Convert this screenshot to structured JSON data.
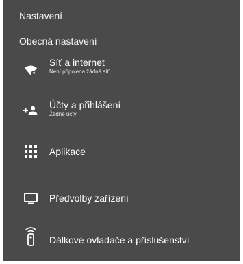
{
  "header": {
    "title": "Nastavení",
    "section_title": "Obecná nastavení"
  },
  "items": [
    {
      "icon": "wifi-icon",
      "label": "Síť a internet",
      "subtitle": "Není připojena žádná síť"
    },
    {
      "icon": "add-account-icon",
      "label": "Účty a přihlášení",
      "subtitle": "Žádné účty"
    },
    {
      "icon": "apps-grid-icon",
      "label": "Aplikace"
    },
    {
      "icon": "tv-icon",
      "label": "Předvolby zařízení"
    },
    {
      "icon": "remote-icon",
      "label": "Dálkové ovladače a příslušenství"
    }
  ]
}
